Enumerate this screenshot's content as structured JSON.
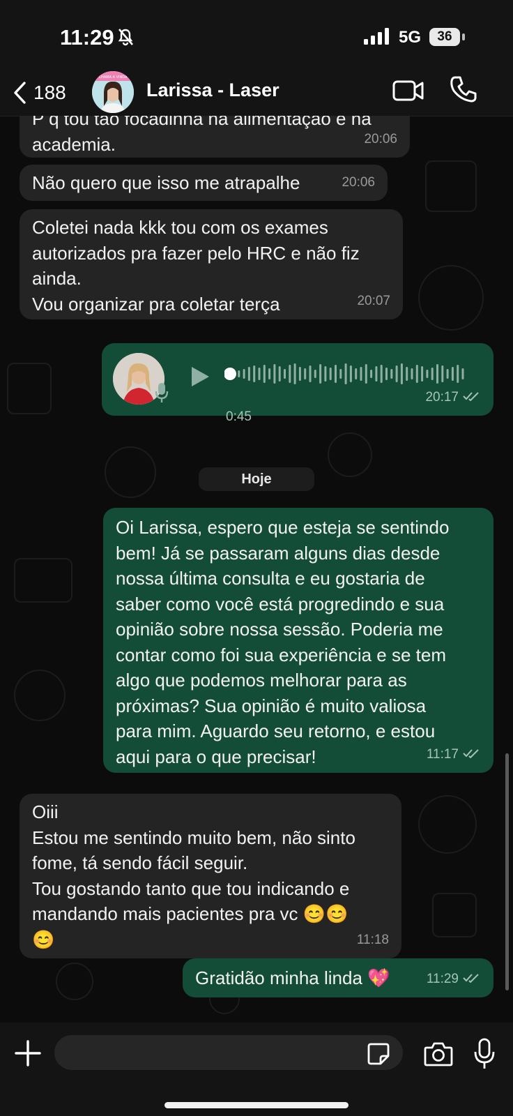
{
  "status_bar": {
    "time": "11:29",
    "network": "5G",
    "battery": "36"
  },
  "header": {
    "back_count": "188",
    "contact_name": "Larissa - Laser",
    "avatar_text": "CHAMA A VINDA"
  },
  "messages": [
    {
      "direction": "incoming",
      "text": "P q tou tão focadinha na alimentação e na\nacademia.",
      "time": "20:06"
    },
    {
      "direction": "incoming",
      "text": "Não quero que isso me atrapalhe",
      "time": "20:06"
    },
    {
      "direction": "incoming",
      "text": "Coletei nada kkk tou com os exames\nautorizados pra fazer pelo HRC e não fiz\nainda.\nVou organizar pra coletar terça",
      "time": "20:07"
    },
    {
      "direction": "outgoing",
      "type": "voice",
      "duration": "0:45",
      "time": "20:17"
    },
    {
      "direction": "outgoing",
      "text": "Oi Larissa, espero que esteja se sentindo\nbem! Já se passaram alguns dias desde\nnossa última consulta e eu gostaria de\nsaber como você está progredindo e sua\nopinião sobre nossa sessão. Poderia me\ncontar como foi sua experiência e se tem\nalgo que podemos melhorar para as\npróximas? Sua opinião é muito valiosa\npara mim. Aguardo seu retorno, e estou\naqui para o que precisar!",
      "time": "11:17"
    },
    {
      "direction": "incoming",
      "text": "Oiii\nEstou me sentindo muito bem, não sinto\nfome, tá sendo fácil seguir.\nTou gostando tanto que tou indicando e\nmandando mais pacientes pra vc 😊😊\n😊",
      "time": "11:18"
    },
    {
      "direction": "outgoing",
      "text": "Gratidão minha linda 💖",
      "time": "11:29"
    }
  ],
  "date_separator": "Hoje",
  "input": {
    "placeholder": ""
  },
  "colors": {
    "incoming_bubble": "#242424",
    "outgoing_bubble": "#144d37",
    "background": "#0c0c0c"
  }
}
